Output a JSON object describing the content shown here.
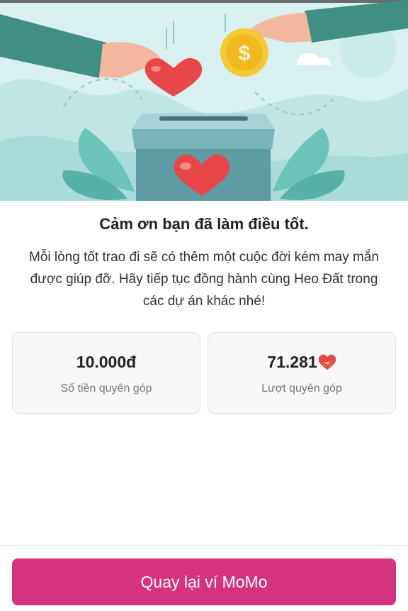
{
  "header": {
    "title": "Cảm ơn bạn đã làm điều tốt.",
    "message_lines": [
      "Mỗi lòng tốt trao đi sẽ có thêm một cuộc đời kém may mắn",
      "được giúp đỡ. Hãy tiếp tục đồng hành cùng Heo Đất trong",
      "các dự án khác nhé!"
    ]
  },
  "stats": [
    {
      "value": "10.000đ",
      "label": "Số tiền quyên góp"
    },
    {
      "value": "71.281",
      "label": "Lượt quyên góp",
      "icon": "heart-face-emoji-icon"
    }
  ],
  "footer": {
    "button_label": "Quay lại ví MoMo"
  },
  "hero": {
    "coin_symbol": "$"
  },
  "colors": {
    "accent": "#d6337e",
    "hero_bg": "#d8f0ef",
    "heart": "#e8474a",
    "coin": "#f5c934",
    "box": "#5f9ba3"
  }
}
